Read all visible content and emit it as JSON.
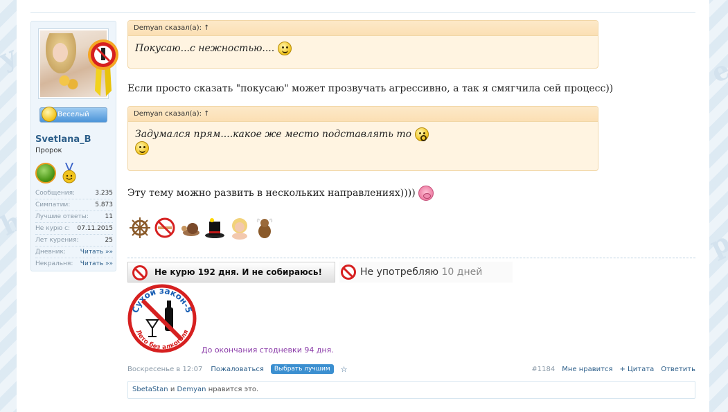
{
  "user": {
    "name": "Svetlana_B",
    "title": "Пророк",
    "mood_label": "Веселый",
    "stats": [
      {
        "label": "Сообщения:",
        "value": "3.235"
      },
      {
        "label": "Симпатии:",
        "value": "5.873"
      },
      {
        "label": "Лучшие ответы:",
        "value": "11"
      },
      {
        "label": "Не курю с:",
        "value": "07.11.2015"
      },
      {
        "label": "Лет курения:",
        "value": "25"
      },
      {
        "label": "Дневник:",
        "value": "Читать »»"
      },
      {
        "label": "Некральня:",
        "value": "Читать »»"
      }
    ]
  },
  "post": {
    "quote1": {
      "header": "Demyan сказал(а): ↑",
      "text": "Покусаю...с нежностью...."
    },
    "text1": "Если просто сказать \"покусаю\" может прозвучать агрессивно, а так я смягчила сей процесс))",
    "quote2": {
      "header": "Demyan сказал(а): ↑",
      "text": "Задумался прям....какое же место подставлять то"
    },
    "text2": "Эту тему можно развить в нескольких направлениях))))",
    "emoji_icons": [
      "ship-wheel-icon",
      "no-smoking-icon",
      "snail-icon",
      "magic-hat-icon",
      "blonde-face-icon",
      "bull-icon"
    ]
  },
  "signature": {
    "banner1": "Не курю 192 дня. И не собираюсь!",
    "banner2_prefix": "Не употребляю",
    "banner2_days": "10 дней",
    "seal_top": "Сухой закон-5",
    "seal_bottom": "Лето без алкоголя",
    "countdown": "До окончания стодневки 94 дня."
  },
  "footer": {
    "date": "Воскресенье в 12:07",
    "report": "Пожаловаться",
    "best": "Выбрать лучшим",
    "star": "☆",
    "post_num": "#1184",
    "like": "Мне нравится",
    "quote": "+ Цитата",
    "reply": "Ответить"
  },
  "likes": {
    "user1": "SbetaStan",
    "and": "и",
    "user2": "Demyan",
    "suffix": "нравится это."
  },
  "colors": {
    "link": "#2d5f8a",
    "quote_bg": "#fff4e1",
    "quote_border": "#f1d6a6",
    "accent_button": "#3b8fd0",
    "countdown": "#8a3aa8"
  }
}
